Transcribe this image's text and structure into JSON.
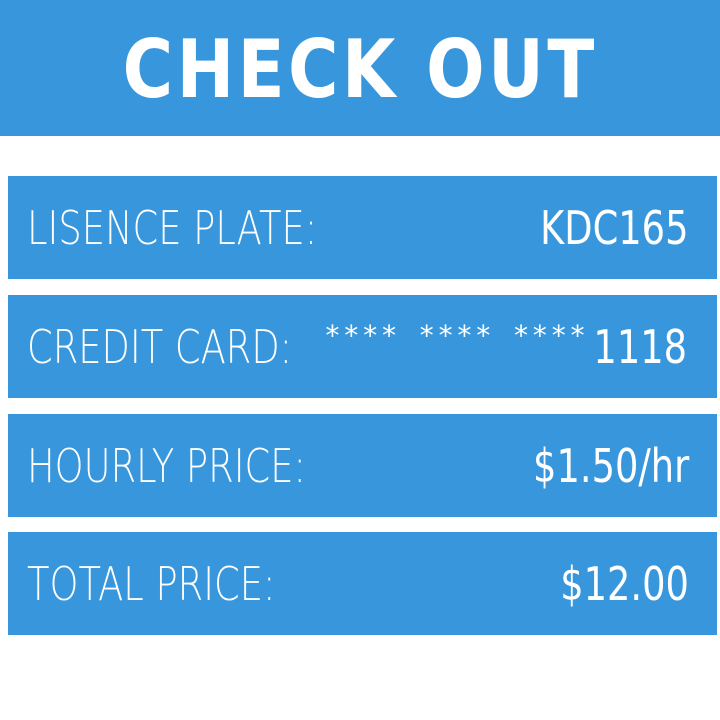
{
  "header": {
    "title": "CHECK OUT"
  },
  "rows": {
    "license_plate": {
      "label": "LISENCE PLATE:",
      "value": "KDC165"
    },
    "credit_card": {
      "label": "CREDIT CARD:",
      "masked": "**** **** ****",
      "last4": "1118"
    },
    "hourly_price": {
      "label": "HOURLY PRICE:",
      "value": "$1.50/hr"
    },
    "total_price": {
      "label": "TOTAL PRICE:",
      "value": "$12.00"
    }
  },
  "colors": {
    "accent": "#3897dc",
    "text": "#ffffff",
    "background": "#ffffff"
  }
}
